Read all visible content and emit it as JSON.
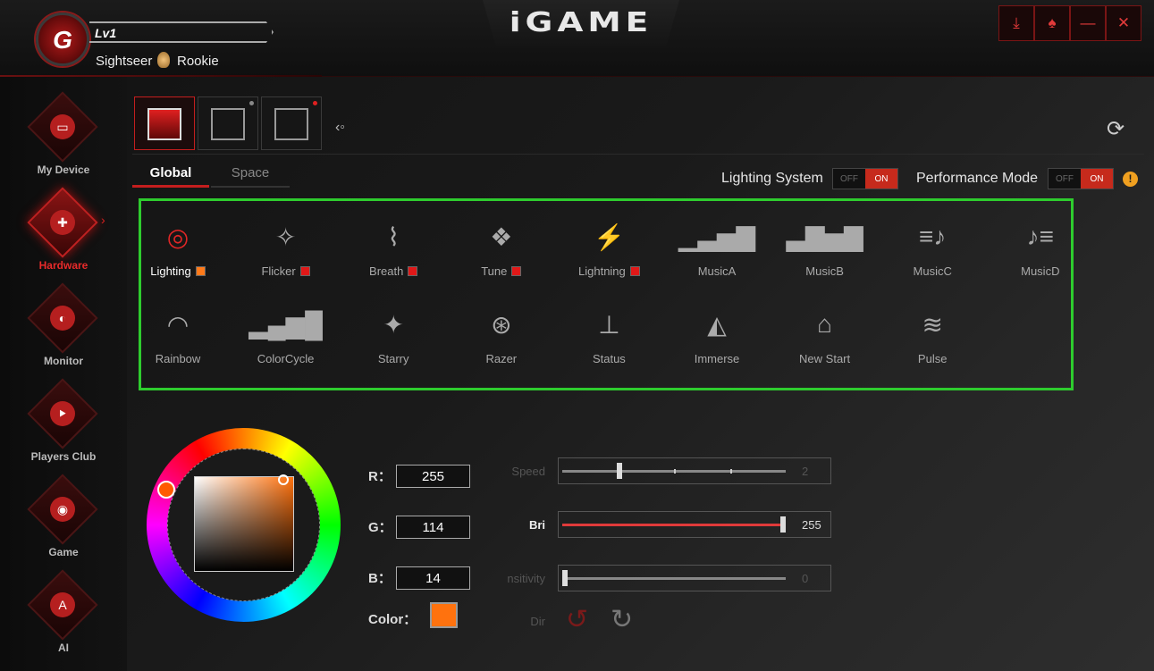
{
  "header": {
    "brand": "iGAME",
    "level": "Lv1",
    "user": "Sightseer",
    "rank": "Rookie",
    "window_buttons": [
      {
        "name": "download-icon",
        "glyph": "⤓"
      },
      {
        "name": "shirt-icon",
        "glyph": "♠"
      },
      {
        "name": "minimize-icon",
        "glyph": "—"
      },
      {
        "name": "close-icon",
        "glyph": "✕"
      }
    ]
  },
  "sidebar": {
    "items": [
      {
        "label": "My Device",
        "glyph": "▭"
      },
      {
        "label": "Hardware",
        "glyph": "✚"
      },
      {
        "label": "Monitor",
        "glyph": "◐"
      },
      {
        "label": "Players Club",
        "glyph": "⯈"
      },
      {
        "label": "Game",
        "glyph": "◉"
      },
      {
        "label": "AI",
        "glyph": "A"
      }
    ],
    "active": "Hardware"
  },
  "devices": [
    {
      "name": "aio-cooler-icon",
      "dot": ""
    },
    {
      "name": "graphics-card-icon",
      "dot": "#888888"
    },
    {
      "name": "motherboard-icon",
      "dot": "#e02020"
    }
  ],
  "tabs": {
    "global": "Global",
    "space": "Space"
  },
  "toggles": {
    "lighting_label": "Lighting System",
    "performance_label": "Performance Mode",
    "off": "OFF",
    "on": "ON"
  },
  "effects": [
    {
      "label": "Lighting",
      "glyph": "◎",
      "swatch": "#ff7a1a",
      "active": true
    },
    {
      "label": "Flicker",
      "glyph": "✧",
      "swatch": "#e01818"
    },
    {
      "label": "Breath",
      "glyph": "⌇",
      "swatch": "#e01818"
    },
    {
      "label": "Tune",
      "glyph": "❖",
      "swatch": "#e01818"
    },
    {
      "label": "Lightning",
      "glyph": "⚡",
      "swatch": "#e01818"
    },
    {
      "label": "MusicA",
      "glyph": "▁▃▅▇"
    },
    {
      "label": "MusicB",
      "glyph": "▃▇▅▇"
    },
    {
      "label": "MusicC",
      "glyph": "≡♪"
    },
    {
      "label": "MusicD",
      "glyph": "♪≡"
    },
    {
      "label": "Rainbow",
      "glyph": "◠"
    },
    {
      "label": "ColorCycle",
      "glyph": "▂▄▆█"
    },
    {
      "label": "Starry",
      "glyph": "✦"
    },
    {
      "label": "Razer",
      "glyph": "⊛"
    },
    {
      "label": "Status",
      "glyph": "⊥"
    },
    {
      "label": "Immerse",
      "glyph": "◭"
    },
    {
      "label": "New Start",
      "glyph": "⌂"
    },
    {
      "label": "Pulse",
      "glyph": "≋"
    }
  ],
  "color": {
    "r_label": "R：",
    "g_label": "G：",
    "b_label": "B：",
    "r": "255",
    "g": "114",
    "b": "14",
    "color_label": "Color：",
    "hex": "#ff720e"
  },
  "sliders": [
    {
      "label": "Speed",
      "value": "2",
      "fraction": 0.25,
      "enabled": false
    },
    {
      "label": "Bri",
      "value": "255",
      "fraction": 1.0,
      "enabled": true
    },
    {
      "label": "nsitivity",
      "value": "0",
      "fraction": 0.0,
      "enabled": false
    }
  ],
  "dir": {
    "label": "Dir"
  }
}
